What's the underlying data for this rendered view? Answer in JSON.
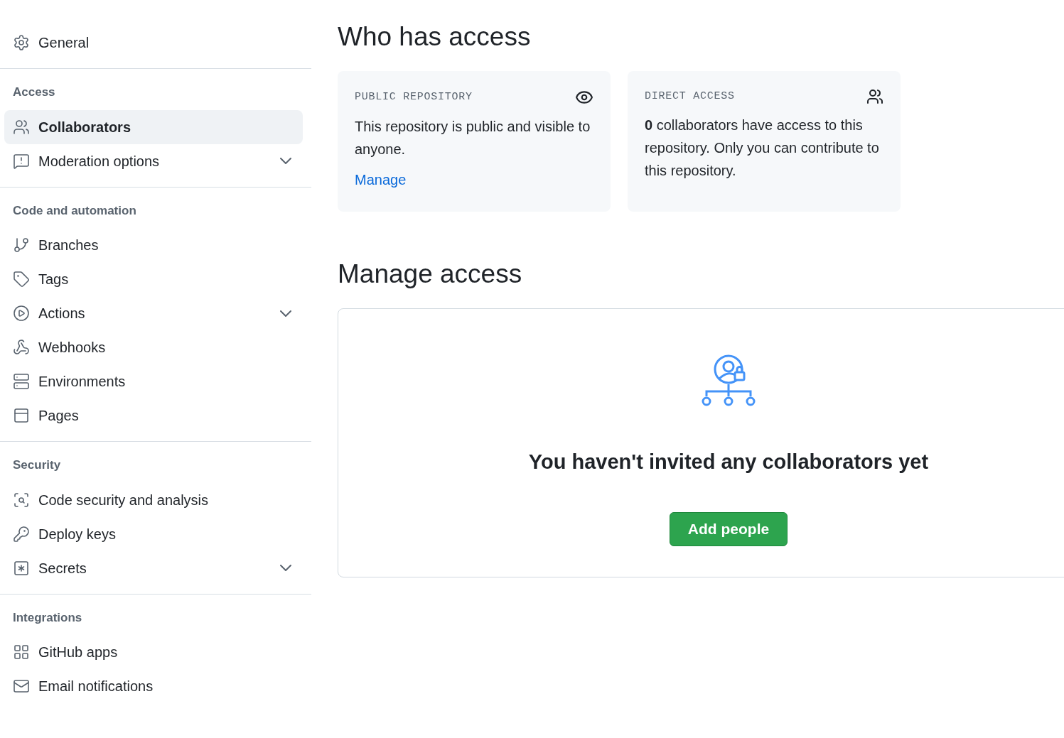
{
  "sidebar": {
    "groups": [
      {
        "items": [
          {
            "label": "General",
            "selected": false,
            "expandable": false
          }
        ]
      },
      {
        "heading": "Access",
        "items": [
          {
            "label": "Collaborators",
            "selected": true,
            "expandable": false
          },
          {
            "label": "Moderation options",
            "selected": false,
            "expandable": true
          }
        ]
      },
      {
        "heading": "Code and automation",
        "items": [
          {
            "label": "Branches",
            "selected": false,
            "expandable": false
          },
          {
            "label": "Tags",
            "selected": false,
            "expandable": false
          },
          {
            "label": "Actions",
            "selected": false,
            "expandable": true
          },
          {
            "label": "Webhooks",
            "selected": false,
            "expandable": false
          },
          {
            "label": "Environments",
            "selected": false,
            "expandable": false
          },
          {
            "label": "Pages",
            "selected": false,
            "expandable": false
          }
        ]
      },
      {
        "heading": "Security",
        "items": [
          {
            "label": "Code security and analysis",
            "selected": false,
            "expandable": false
          },
          {
            "label": "Deploy keys",
            "selected": false,
            "expandable": false
          },
          {
            "label": "Secrets",
            "selected": false,
            "expandable": true
          }
        ]
      },
      {
        "heading": "Integrations",
        "items": [
          {
            "label": "GitHub apps",
            "selected": false,
            "expandable": false
          },
          {
            "label": "Email notifications",
            "selected": false,
            "expandable": false
          }
        ]
      }
    ]
  },
  "who_has_access": {
    "title": "Who has access",
    "cards": [
      {
        "label": "PUBLIC REPOSITORY",
        "text": "This repository is public and visible to anyone.",
        "link": "Manage"
      },
      {
        "label": "DIRECT ACCESS",
        "text": "**0** collaborators have access to this repository. Only you can contribute to this repository."
      }
    ]
  },
  "manage_access": {
    "title": "Manage access",
    "empty_message": "You haven't invited any collaborators yet",
    "button": "Add people"
  }
}
